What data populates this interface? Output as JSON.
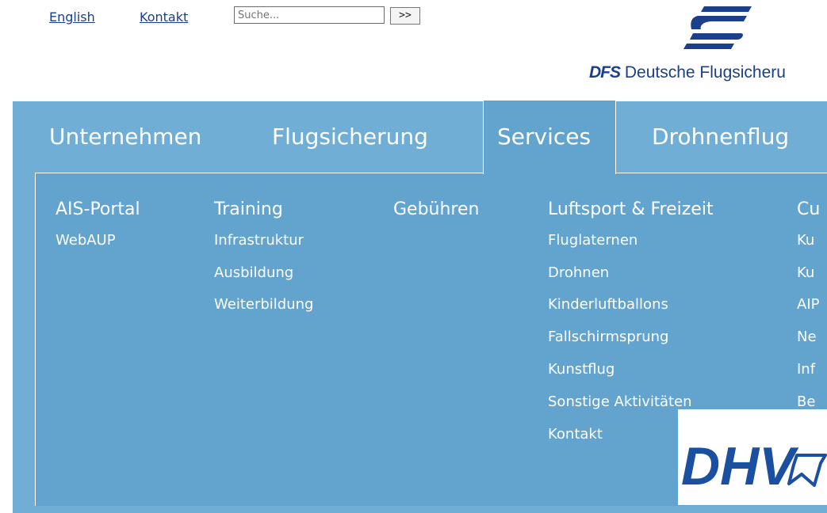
{
  "top": {
    "english_label": "English",
    "kontakt_label": "Kontakt",
    "search_placeholder": "Suche...",
    "search_button": ">>"
  },
  "logo": {
    "abbr": "DFS",
    "name": "Deutsche Flugsicheru",
    "brand_color": "#1b3f8b"
  },
  "nav": {
    "tabs": [
      {
        "label": "Unternehmen"
      },
      {
        "label": "Flugsicherung"
      },
      {
        "label": "Services",
        "active": true
      },
      {
        "label": "Drohnenflug"
      }
    ]
  },
  "menu": {
    "col1": {
      "head": "AIS-Portal",
      "items": [
        "WebAUP"
      ]
    },
    "col2": {
      "head": "Training",
      "items": [
        "Infrastruktur",
        "Ausbildung",
        "Weiterbildung"
      ]
    },
    "col3": {
      "head": "Gebühren",
      "items": []
    },
    "col4": {
      "head": "Luftsport & Freizeit",
      "items": [
        "Fluglaternen",
        "Drohnen",
        "Kinderluftballons",
        "Fallschirmsprung",
        "Kunstflug",
        "Sonstige Aktivitäten",
        "Kontakt"
      ]
    },
    "col5": {
      "head": "Cu",
      "items": [
        "Ku",
        "Ku",
        "AIP",
        "Ne",
        "Inf",
        "Be"
      ]
    }
  },
  "badge": {
    "text": "DHV"
  },
  "colors": {
    "nav_bg": "#70aed5",
    "panel_bg": "#63a4cf",
    "text": "#ffffff"
  }
}
